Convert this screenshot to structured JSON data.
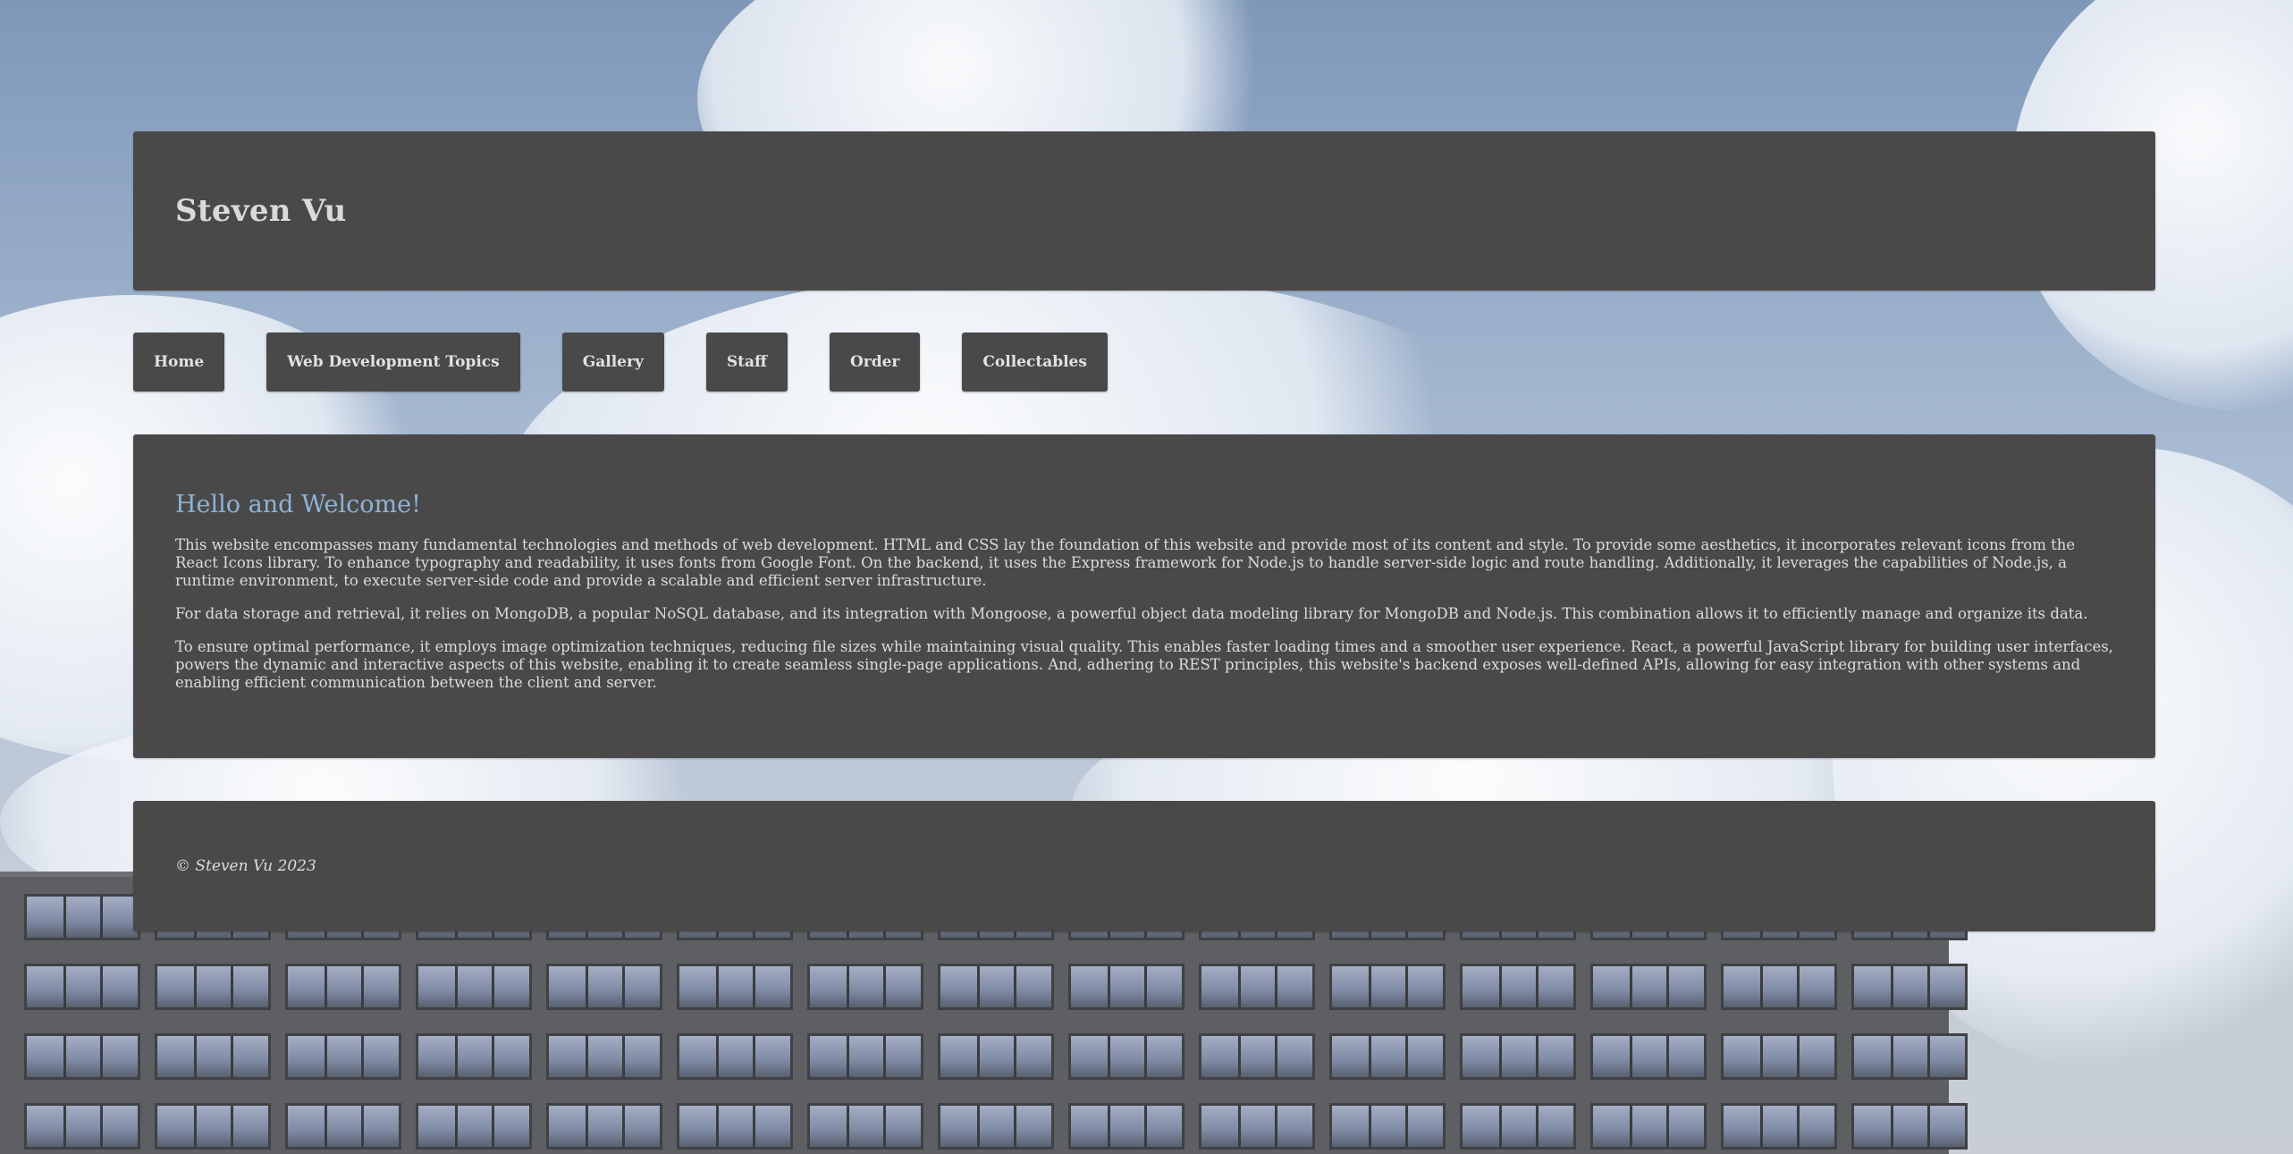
{
  "header": {
    "title": "Steven Vu"
  },
  "nav": {
    "items": [
      {
        "label": "Home"
      },
      {
        "label": "Web Development Topics"
      },
      {
        "label": "Gallery"
      },
      {
        "label": "Staff"
      },
      {
        "label": "Order"
      },
      {
        "label": "Collectables"
      }
    ]
  },
  "main": {
    "heading": "Hello and Welcome!",
    "paragraphs": [
      "This website encompasses many fundamental technologies and methods of web development. HTML and CSS lay the foundation of this website and provide most of its content and style. To provide some aesthetics, it incorporates relevant icons from the React Icons library. To enhance typography and readability, it uses fonts from Google Font. On the backend, it uses the Express framework for Node.js to handle server-side logic and route handling. Additionally, it leverages the capabilities of Node.js, a runtime environment, to execute server-side code and provide a scalable and efficient server infrastructure.",
      "For data storage and retrieval, it relies on MongoDB, a popular NoSQL database, and its integration with Mongoose, a powerful object data modeling library for MongoDB and Node.js. This combination allows it to efficiently manage and organize its data.",
      "To ensure optimal performance, it employs image optimization techniques, reducing file sizes while maintaining visual quality. This enables faster loading times and a smoother user experience. React, a powerful JavaScript library for building user interfaces, powers the dynamic and interactive aspects of this website, enabling it to create seamless single-page applications. And, adhering to REST principles, this website's backend exposes well-defined APIs, allowing for easy integration with other systems and enabling efficient communication between the client and server."
    ]
  },
  "footer": {
    "copyright": "© Steven Vu 2023"
  },
  "colors": {
    "panel": "#4a4949",
    "heading_accent": "#8fb2d6",
    "text": "#dedcda"
  }
}
